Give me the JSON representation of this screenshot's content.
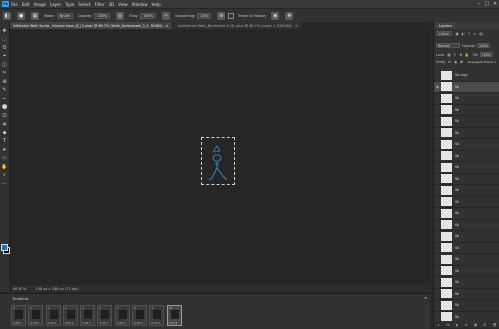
{
  "app": {
    "logo": "Ps"
  },
  "menu": [
    "File",
    "Edit",
    "Image",
    "Layer",
    "Type",
    "Select",
    "Filter",
    "3D",
    "View",
    "Window",
    "Help"
  ],
  "window_controls": [
    "–",
    "□",
    "✕"
  ],
  "options": {
    "mode_label": "Mode:",
    "mode_value": "Brush",
    "opacity_label": "Opacity:",
    "opacity_value": "100%",
    "flow_label": "Flow:",
    "flow_value": "100%",
    "smoothing_label": "Smoothing:",
    "smoothing_value": "10%",
    "erase_label": "Erase to History"
  },
  "tabs": [
    {
      "label": "Inflatable Walk Sprite_ Horizon hoon_B_(3 pixel @ 66.7% (Walk_Spritesheet_0_0, RGB/8)",
      "active": true
    },
    {
      "label": "Spritesheet Walk_Borderline B (3) pixel @ 66.7% (Layer 1, RGB/8#)",
      "active": false
    }
  ],
  "tools": [
    "✥",
    "⬚",
    "ʘ",
    "⌖",
    "◫",
    "✂",
    "⊕",
    "✎",
    "⌁",
    "⬤",
    "⎚",
    "⬙",
    "◆",
    "T",
    "➤",
    "▭",
    "✋",
    "⌕",
    "⋯"
  ],
  "status": {
    "zoom": "66.67%",
    "doc": "198 px x 188 px (72 ppi)"
  },
  "timeline": {
    "title": "Timeline",
    "close": "≡",
    "controls": [
      "Forever ▾",
      "⏮",
      "◀",
      "▶",
      "▶|"
    ],
    "frames": [
      {
        "num": "1",
        "delay": "0.05 ▾"
      },
      {
        "num": "2",
        "delay": "0.05 ▾"
      },
      {
        "num": "3",
        "delay": "0.05 ▾"
      },
      {
        "num": "4",
        "delay": "0.05 ▾"
      },
      {
        "num": "5",
        "delay": "0.05 ▾"
      },
      {
        "num": "6",
        "delay": "0.05 ▾"
      },
      {
        "num": "7",
        "delay": "0.05 ▾"
      },
      {
        "num": "8",
        "delay": "0.05 ▾"
      },
      {
        "num": "9",
        "delay": "0.05 ▾"
      },
      {
        "num": "10",
        "delay": "0.05 ▾"
      }
    ]
  },
  "layers_panel": {
    "tab": "Layers",
    "kind": "Q Kind",
    "blend": "Normal",
    "opacity_label": "Opacity:",
    "opacity_value": "100%",
    "lock_label": "Lock:",
    "fill_label": "Fill:",
    "fill_value": "100%",
    "propagate": "Propagate Frame 1",
    "unify_label": "Unify:",
    "layers": [
      {
        "name": "Sb copy",
        "selected": false
      },
      {
        "name": "Sb",
        "selected": true
      },
      {
        "name": "Sb",
        "selected": false
      },
      {
        "name": "Sb",
        "selected": false
      },
      {
        "name": "Sb",
        "selected": false
      },
      {
        "name": "Sb",
        "selected": false
      },
      {
        "name": "Sb",
        "selected": false
      },
      {
        "name": "Sb",
        "selected": false
      },
      {
        "name": "Sb",
        "selected": false
      },
      {
        "name": "Sb",
        "selected": false
      },
      {
        "name": "Sb",
        "selected": false
      },
      {
        "name": "Sb",
        "selected": false
      },
      {
        "name": "Sb",
        "selected": false
      },
      {
        "name": "Sb",
        "selected": false
      },
      {
        "name": "Sb",
        "selected": false
      },
      {
        "name": "Sb",
        "selected": false
      },
      {
        "name": "Sb",
        "selected": false
      },
      {
        "name": "Sb",
        "selected": false
      },
      {
        "name": "Sb",
        "selected": false
      },
      {
        "name": "Sb",
        "selected": false
      },
      {
        "name": "Sb",
        "selected": false
      },
      {
        "name": "Sb",
        "selected": false
      }
    ],
    "bottom_icons": [
      "∞",
      "fx",
      "◐",
      "⊘",
      "▣",
      "⊞",
      "🗑"
    ]
  }
}
